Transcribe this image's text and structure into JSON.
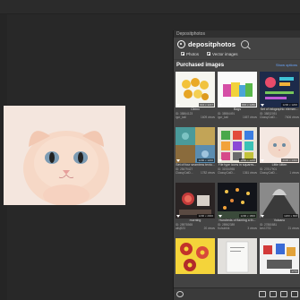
{
  "panel": {
    "title": "Depositphotos",
    "logo_text": "depositphotos",
    "filters": {
      "photos": "Photos",
      "vectors": "Vector images"
    },
    "section_title": "Purchased images",
    "more_link": "Show options"
  },
  "items": [
    {
      "title": "Cibinx",
      "size": "904 x 1217",
      "id": "ID: 38864123",
      "user": "igor_kali",
      "stat": "1609 views"
    },
    {
      "title": "Bags",
      "size": "800 x 1280",
      "id": "ID: 38984491",
      "user": "igor_kali",
      "stat": "1657 views"
    },
    {
      "title": "Set of infographic elemen...",
      "size": "1200 x 1200",
      "id": "ID: 38832051",
      "user": "ClassyCatD...",
      "stat": "7606 views"
    },
    {
      "title": "Set of four seamless textu...",
      "size": "1200 x 1200",
      "id": "ID: 28479427",
      "user": "ClassyCatD...",
      "stat": "1782 views"
    },
    {
      "title": "File type icons in squares...",
      "size": "1200 x 1200",
      "id": "ID: 31934955",
      "user": "ClassyCatD...",
      "stat": "1361 views"
    },
    {
      "title": "Little kitten",
      "size": "2000 x 1333",
      "id": "ID: 27817901",
      "user": "ClassyCatD...",
      "stat": "1 views"
    },
    {
      "title": "morning",
      "size": "1200 x 2000",
      "id": "ID: 28978565",
      "user": "alisj923",
      "stat": "20 views"
    },
    {
      "title": "Hundreds of flaming a th...",
      "size": "1200 x 1800",
      "id": "ID: 28962389",
      "user": "Kuhubhik",
      "stat": "3 views"
    },
    {
      "title": "Volcano",
      "size": "1200 x 800",
      "id": "ID: 27880881",
      "user": "kev17S3",
      "stat": "21 views"
    },
    {
      "title": "",
      "size": "",
      "id": "",
      "user": "",
      "stat": ""
    },
    {
      "title": "",
      "size": "",
      "id": "",
      "user": "",
      "stat": ""
    },
    {
      "title": "",
      "size": "1776",
      "id": "",
      "user": "",
      "stat": ""
    }
  ]
}
